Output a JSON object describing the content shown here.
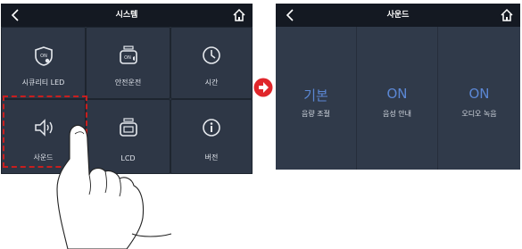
{
  "left_screen": {
    "title": "시스템",
    "back_icon": "chevron-left-icon",
    "home_icon": "home-icon",
    "tiles": [
      {
        "label": "시큐리티 LED",
        "icon": "security-led-icon"
      },
      {
        "label": "안전운전",
        "icon": "safe-driving-icon"
      },
      {
        "label": "시간",
        "icon": "clock-icon"
      },
      {
        "label": "사운드",
        "icon": "speaker-icon"
      },
      {
        "label": "LCD",
        "icon": "lcd-icon"
      },
      {
        "label": "버전",
        "icon": "info-icon"
      }
    ],
    "highlighted_tile": "사운드"
  },
  "right_screen": {
    "title": "사운드",
    "back_icon": "chevron-left-icon",
    "home_icon": "home-icon",
    "items": [
      {
        "value": "기본",
        "label": "음량 조절"
      },
      {
        "value": "ON",
        "label": "음성 안내"
      },
      {
        "value": "ON",
        "label": "오디오 녹음"
      }
    ]
  },
  "colors": {
    "panel_bg": "#2b3442",
    "topbar_bg": "#141922",
    "value_accent": "#5b87d4",
    "highlight": "#c81e1e",
    "transition_arrow": "#e0262b"
  },
  "transition_icon": "arrow-right-icon",
  "pointer_icon": "hand-pointer-icon"
}
